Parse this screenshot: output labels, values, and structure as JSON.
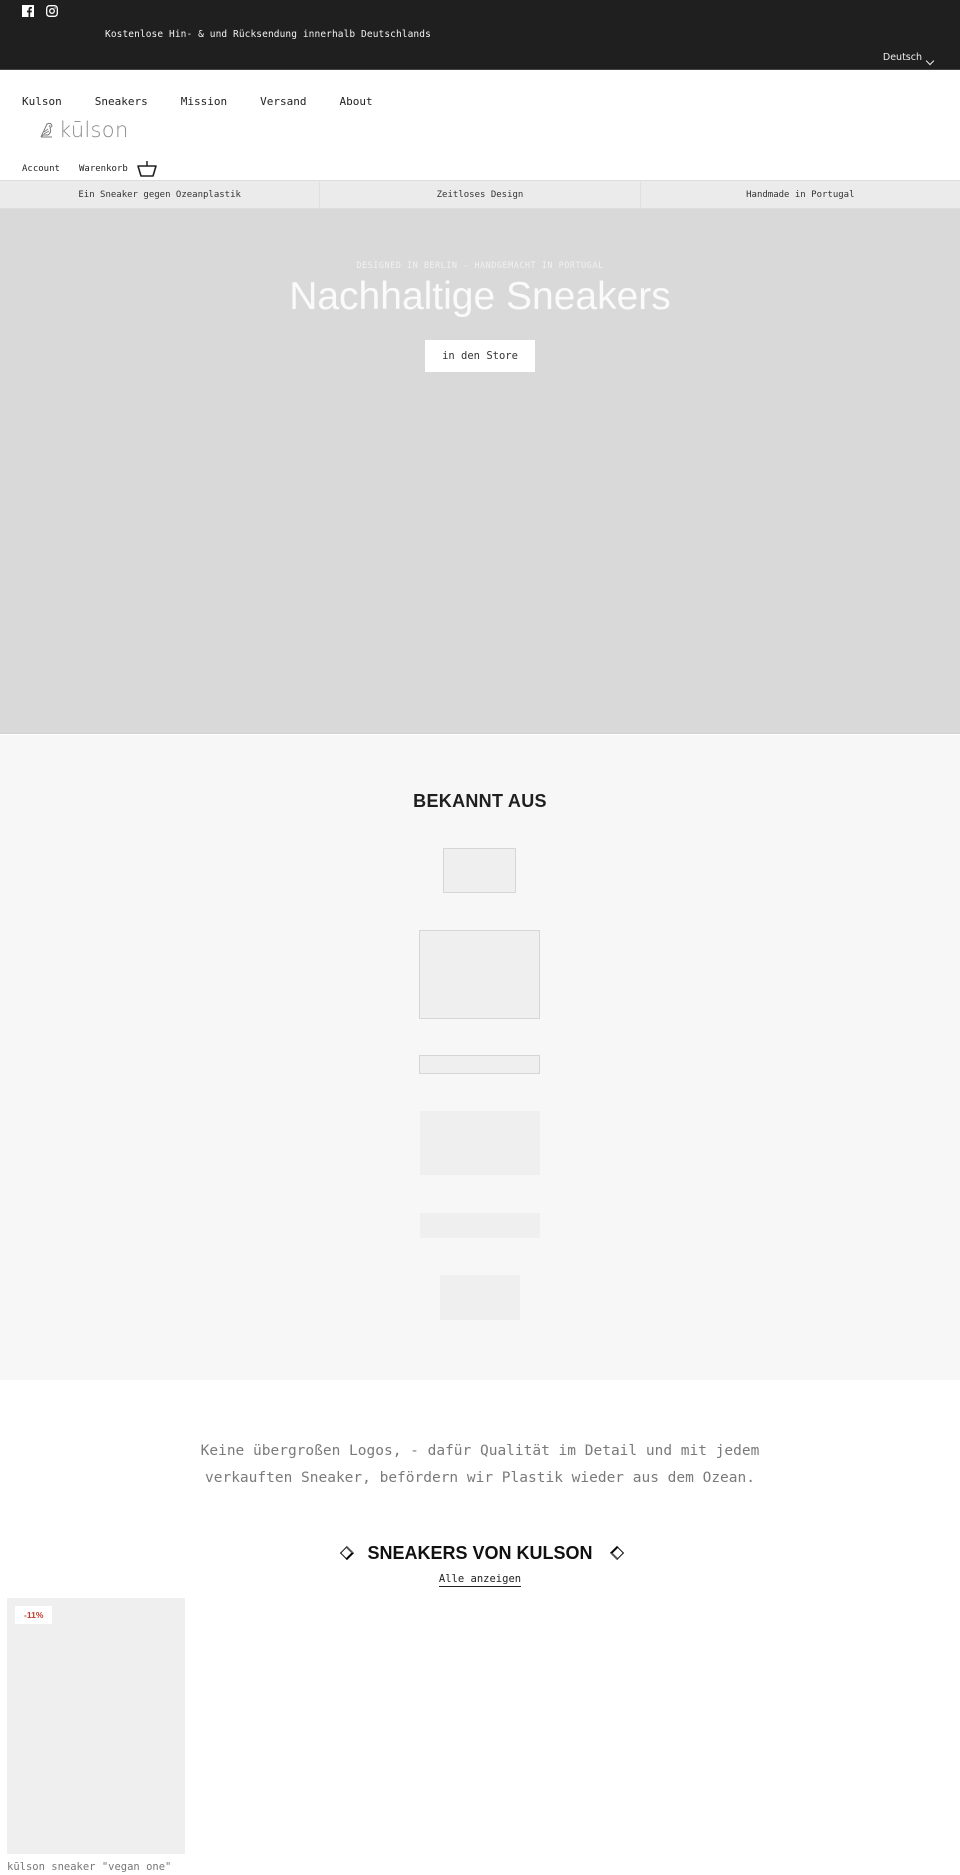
{
  "topbar": {
    "social": [
      {
        "name": "facebook",
        "icon": "facebook-icon"
      },
      {
        "name": "instagram",
        "icon": "instagram-icon"
      }
    ],
    "announcement": "Kostenlose Hin- & und Rücksendung innerhalb Deutschlands",
    "language": "Deutsch"
  },
  "header": {
    "nav": [
      "Kulson",
      "Sneakers",
      "Mission",
      "Versand",
      "About"
    ],
    "logo_text": "kūlson",
    "account_label": "Account",
    "cart_label": "Warenkorb"
  },
  "usp": [
    "Ein Sneaker gegen Ozeanplastik",
    "Zeitloses Design",
    "Handmade in Portugal"
  ],
  "hero": {
    "eyebrow": "DESIGNED IN BERLIN - HANDGEMACHT IN PORTUGAL",
    "title": "Nachhaltige Sneakers",
    "button_label": "in den Store"
  },
  "press": {
    "title": "BEKANNT AUS",
    "logos_count": 6
  },
  "mission": {
    "line1": "Keine übergroßen Logos, - dafür Qualität im Detail und mit jedem",
    "line2": "verkauften Sneaker, befördern wir Plastik wieder aus dem Ozean."
  },
  "carousel": {
    "title": "SNEAKERS VON KULSON",
    "view_all": "Alle anzeigen",
    "products": [
      {
        "name": "kūlson sneaker \"vegan one\"",
        "badge": "-11%"
      }
    ]
  },
  "colors": {
    "topbar_bg": "#1f1f1f",
    "hero_bg": "#d9d9d9",
    "press_bg": "#f7f7f7",
    "sale_badge": "#c0392b"
  }
}
